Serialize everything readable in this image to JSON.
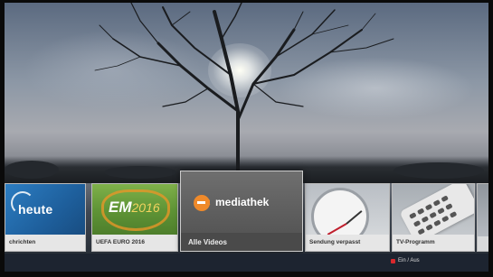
{
  "tiles": [
    {
      "id": "heute",
      "logo": "heute",
      "caption": "chrichten"
    },
    {
      "id": "em",
      "logo_main": "EM",
      "logo_year": "2016",
      "caption": "UEFA EURO 2016"
    },
    {
      "id": "mediathek",
      "logo_small": "2",
      "logo_text": "mediathek",
      "caption": "Alle Videos"
    },
    {
      "id": "sendung",
      "caption": "Sendung verpasst"
    },
    {
      "id": "tv",
      "caption": "TV-Programm"
    }
  ],
  "bottom_bar": {
    "toggle_label": "Ein / Aus",
    "toggle_color": "#d8282c"
  },
  "colors": {
    "accent": "#f08a2a",
    "heute_blue": "#2c7dc2"
  }
}
